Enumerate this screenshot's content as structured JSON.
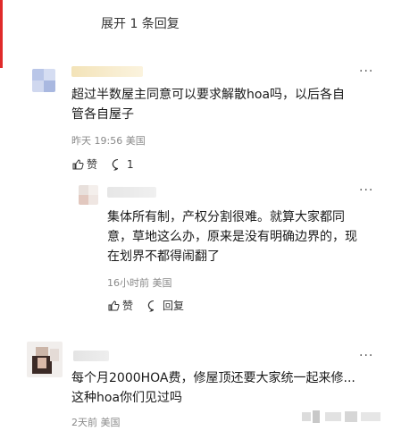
{
  "thread": {
    "expand_label": "展开 1 条回复"
  },
  "comments": [
    {
      "text": "超过半数屋主同意可以要求解散hoa吗，以后各自管各自屋子",
      "time": "昨天 19:56",
      "location": "美国",
      "like_label": "赞",
      "reply_count": "1"
    },
    {
      "text": "集体所有制，产权分割很难。就算大家都同意，草地这么办，原来是没有明确边界的，现在划界不都得闹翻了",
      "time": "16小时前",
      "location": "美国",
      "like_label": "赞",
      "reply_label": "回复"
    },
    {
      "text": "每个月2000HOA费，修屋顶还要大家统一起来修...这种hoa你们见过吗",
      "time": "2天前",
      "location": "美国"
    }
  ],
  "icons": {
    "more": "more-dots-icon",
    "like": "thumbs-up-icon",
    "comment": "comment-bubble-icon"
  },
  "colors": {
    "accent_edge": "#e02a2a",
    "meta_text": "#8a8a8a"
  }
}
